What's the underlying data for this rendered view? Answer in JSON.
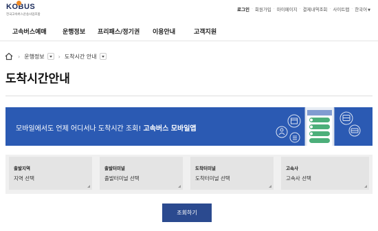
{
  "header": {
    "logo_text": "KOBUS",
    "logo_sub": "전국고속버스운송사업조합",
    "util_menu": [
      "로그인",
      "회원가입",
      "마이페이지",
      "결제내역조회",
      "사이트맵",
      "한국어"
    ]
  },
  "nav": {
    "items": [
      "고속버스예매",
      "운행정보",
      "프리패스/정기권",
      "이용안내",
      "고객지원"
    ]
  },
  "breadcrumb": {
    "items": [
      "운행정보",
      "도착시간 안내"
    ]
  },
  "page": {
    "title": "도착시간안내"
  },
  "banner": {
    "text_prefix": "모바일에서도 언제 어디서나 도착시간 조회! ",
    "text_bold": "고속버스 모바일앱"
  },
  "selects": [
    {
      "label": "출발지역",
      "value": "지역 선택"
    },
    {
      "label": "출발터미널",
      "value": "출발터미널 선택"
    },
    {
      "label": "도착터미널",
      "value": "도착터미널 선택"
    },
    {
      "label": "고속사",
      "value": "고속사 선택"
    }
  ],
  "search_button": "조회하기",
  "colors": {
    "banner": "#2b5ab3",
    "button": "#2b4a8f",
    "logo_accent": "#f08a24"
  }
}
